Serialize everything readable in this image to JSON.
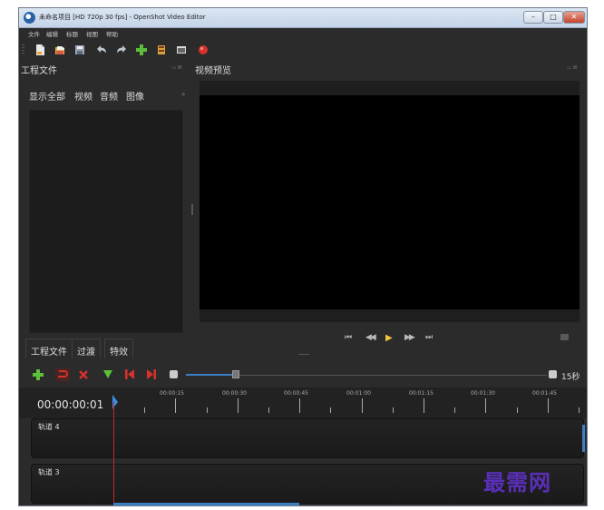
{
  "window": {
    "title": "未命名项目 [HD 720p 30 fps] - OpenShot Video Editor",
    "controls": {
      "minimize": "–",
      "maximize": "□",
      "close": "✕"
    }
  },
  "menu": [
    "文件",
    "编辑",
    "标题",
    "视图",
    "帮助"
  ],
  "toolbar": {
    "icons": [
      "new-project-icon",
      "open-project-icon",
      "save-project-icon",
      "undo-icon",
      "redo-icon",
      "import-files-icon",
      "profile-icon",
      "fullscreen-icon",
      "export-video-icon"
    ]
  },
  "project_files_panel": {
    "title": "工程文件",
    "controls": "▭⊠",
    "filters": [
      "显示全部",
      "视频",
      "音频",
      "图像"
    ],
    "more": "»"
  },
  "preview_panel": {
    "title": "视频预览",
    "controls": "▭⊠"
  },
  "player": {
    "buttons": [
      "jump-start",
      "rewind",
      "play",
      "fast-forward",
      "jump-end"
    ],
    "glyphs": {
      "jump_start": "⏮",
      "rewind": "◀◀",
      "play": "▶",
      "fast_forward": "▶▶",
      "jump_end": "⏭"
    }
  },
  "bottom_tabs": [
    "工程文件",
    "过渡",
    "特效"
  ],
  "timeline": {
    "zoom_label": "15秒",
    "zoom_level": 0.14,
    "timecode": "00:00:00:01",
    "ruler_labels": [
      "00:00:15",
      "00:00:30",
      "00:00:45",
      "00:01:00",
      "00:01:15",
      "00:01:30",
      "00:01:45"
    ],
    "tracks": [
      "轨道 4",
      "轨道 3"
    ]
  },
  "watermark": "最需网",
  "colors": {
    "accent_blue": "#3a7fc4",
    "play_yellow": "#f2c53d",
    "add_green": "#5bbf3a",
    "snap_red": "#d8312b",
    "playhead_red": "#c62828"
  }
}
